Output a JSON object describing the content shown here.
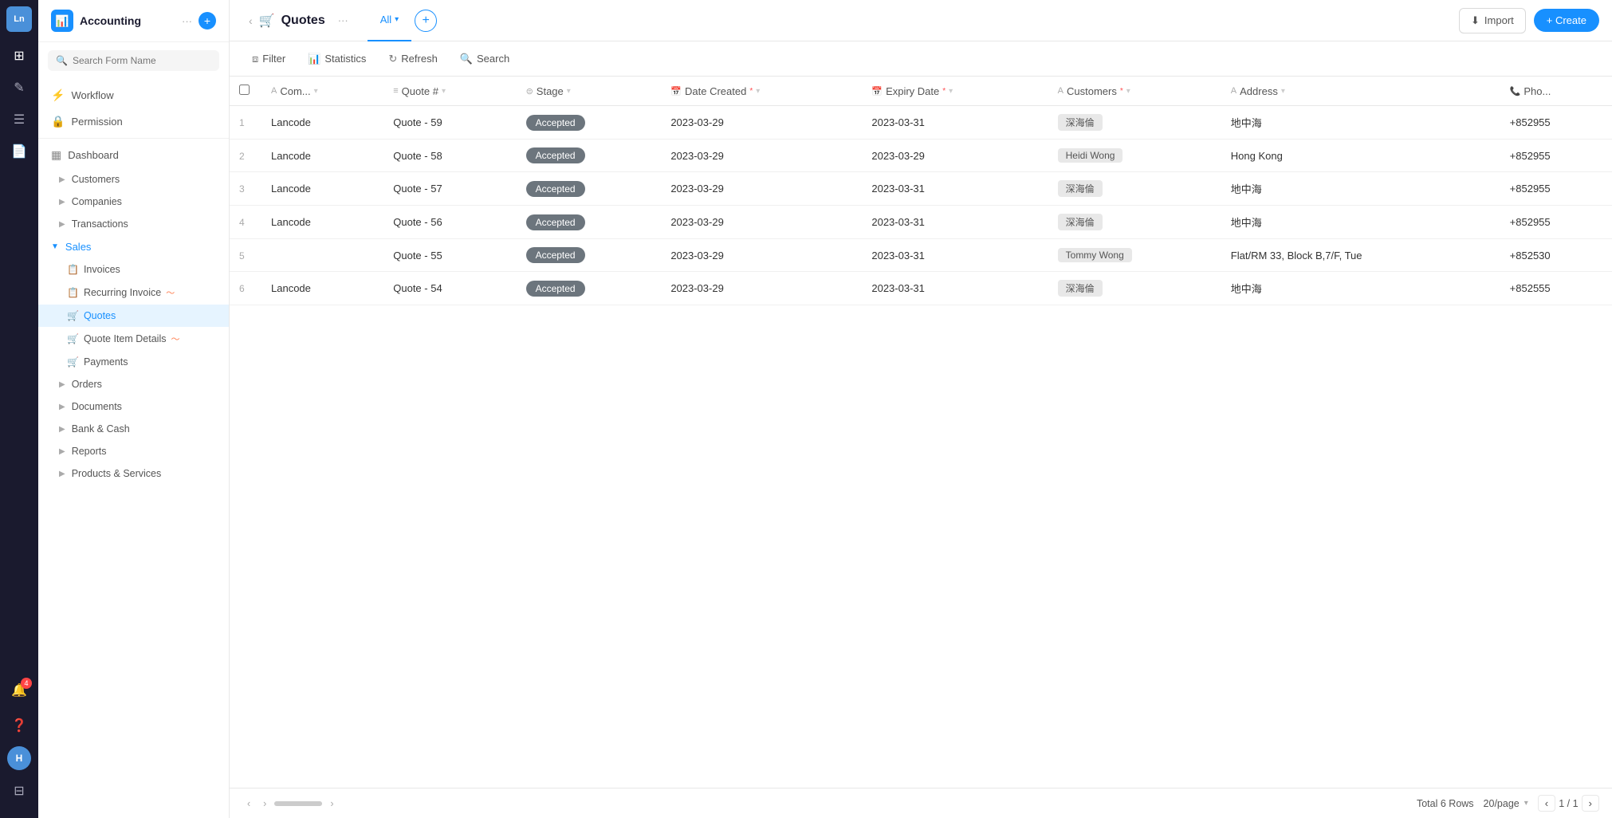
{
  "app": {
    "initials": "Ln",
    "title": "Accounting",
    "icon": "📊"
  },
  "icon_bar": {
    "items": [
      {
        "name": "grid-icon",
        "symbol": "⊞",
        "active": false
      },
      {
        "name": "brush-icon",
        "symbol": "✏️",
        "active": false
      },
      {
        "name": "list-icon",
        "symbol": "☰",
        "active": false
      },
      {
        "name": "chart-icon",
        "symbol": "📄",
        "active": false
      }
    ],
    "bottom_items": [
      {
        "name": "bell-icon",
        "symbol": "🔔",
        "badge": "4"
      },
      {
        "name": "help-icon",
        "symbol": "❓"
      },
      {
        "name": "user-avatar",
        "initials": "H",
        "is_avatar": true
      },
      {
        "name": "settings-icon",
        "symbol": "⊟"
      }
    ]
  },
  "sidebar": {
    "search_placeholder": "Search Form Name",
    "nav_items": [
      {
        "label": "Workflow",
        "icon": "⚡",
        "name": "workflow"
      },
      {
        "label": "Permission",
        "icon": "🔒",
        "name": "permission"
      }
    ],
    "dashboard_label": "Dashboard",
    "groups": [
      {
        "label": "Customers",
        "expanded": false,
        "name": "customers"
      },
      {
        "label": "Companies",
        "expanded": false,
        "name": "companies"
      },
      {
        "label": "Transactions",
        "expanded": false,
        "name": "transactions"
      }
    ],
    "sales_label": "Sales",
    "sales_items": [
      {
        "label": "Invoices",
        "icon": "📋",
        "name": "invoices",
        "active": false
      },
      {
        "label": "Recurring Invoice",
        "icon": "📋",
        "name": "recurring-invoice",
        "active": false,
        "badge": "~"
      },
      {
        "label": "Quotes",
        "icon": "🛒",
        "name": "quotes",
        "active": true
      },
      {
        "label": "Quote Item Details",
        "icon": "🛒",
        "name": "quote-item-details",
        "active": false,
        "badge": "~"
      },
      {
        "label": "Payments",
        "icon": "🛒",
        "name": "payments",
        "active": false
      }
    ],
    "other_groups": [
      {
        "label": "Orders",
        "expanded": false,
        "name": "orders"
      },
      {
        "label": "Documents",
        "expanded": false,
        "name": "documents"
      },
      {
        "label": "Bank & Cash",
        "expanded": false,
        "name": "bank-cash"
      },
      {
        "label": "Reports",
        "expanded": false,
        "name": "reports"
      },
      {
        "label": "Products & Services",
        "expanded": false,
        "name": "products-services"
      }
    ]
  },
  "topbar": {
    "title": "Quotes",
    "icon": "🛒",
    "tabs": [
      {
        "label": "All",
        "active": true
      },
      {
        "label": "+",
        "is_plus": true
      }
    ],
    "import_label": "Import",
    "create_label": "+ Create"
  },
  "toolbar": {
    "filter_label": "Filter",
    "statistics_label": "Statistics",
    "refresh_label": "Refresh",
    "search_label": "Search"
  },
  "table": {
    "columns": [
      {
        "label": "Com...",
        "key": "company",
        "sortable": true
      },
      {
        "label": "Quote #",
        "key": "quote_num",
        "sortable": true
      },
      {
        "label": "Stage",
        "key": "stage",
        "sortable": true
      },
      {
        "label": "Date Created",
        "key": "date_created",
        "sortable": true,
        "required": true
      },
      {
        "label": "Expiry Date",
        "key": "expiry_date",
        "sortable": true,
        "required": true
      },
      {
        "label": "Customers",
        "key": "customers",
        "sortable": true,
        "required": true
      },
      {
        "label": "Address",
        "key": "address",
        "sortable": true
      },
      {
        "label": "Pho...",
        "key": "phone",
        "sortable": false
      }
    ],
    "rows": [
      {
        "num": 1,
        "company": "Lancode",
        "quote_num": "Quote - 59",
        "stage": "Accepted",
        "date_created": "2023-03-29",
        "expiry_date": "2023-03-31",
        "customer": "深海倫",
        "address": "地中海",
        "phone": "+852955"
      },
      {
        "num": 2,
        "company": "Lancode",
        "quote_num": "Quote - 58",
        "stage": "Accepted",
        "date_created": "2023-03-29",
        "expiry_date": "2023-03-29",
        "customer": "Heidi Wong",
        "address": "Hong Kong",
        "phone": "+852955"
      },
      {
        "num": 3,
        "company": "Lancode",
        "quote_num": "Quote - 57",
        "stage": "Accepted",
        "date_created": "2023-03-29",
        "expiry_date": "2023-03-31",
        "customer": "深海倫",
        "address": "地中海",
        "phone": "+852955"
      },
      {
        "num": 4,
        "company": "Lancode",
        "quote_num": "Quote - 56",
        "stage": "Accepted",
        "date_created": "2023-03-29",
        "expiry_date": "2023-03-31",
        "customer": "深海倫",
        "address": "地中海",
        "phone": "+852955"
      },
      {
        "num": 5,
        "company": "",
        "quote_num": "Quote - 55",
        "stage": "Accepted",
        "date_created": "2023-03-29",
        "expiry_date": "2023-03-31",
        "customer": "Tommy Wong",
        "address": "Flat/RM 33, Block B,7/F, Tue",
        "phone": "+852530"
      },
      {
        "num": 6,
        "company": "Lancode",
        "quote_num": "Quote - 54",
        "stage": "Accepted",
        "date_created": "2023-03-29",
        "expiry_date": "2023-03-31",
        "customer": "深海倫",
        "address": "地中海",
        "phone": "+852555"
      }
    ]
  },
  "footer": {
    "total_rows_label": "Total 6 Rows",
    "per_page_label": "20/page",
    "page_current": "1",
    "page_total": "1"
  }
}
